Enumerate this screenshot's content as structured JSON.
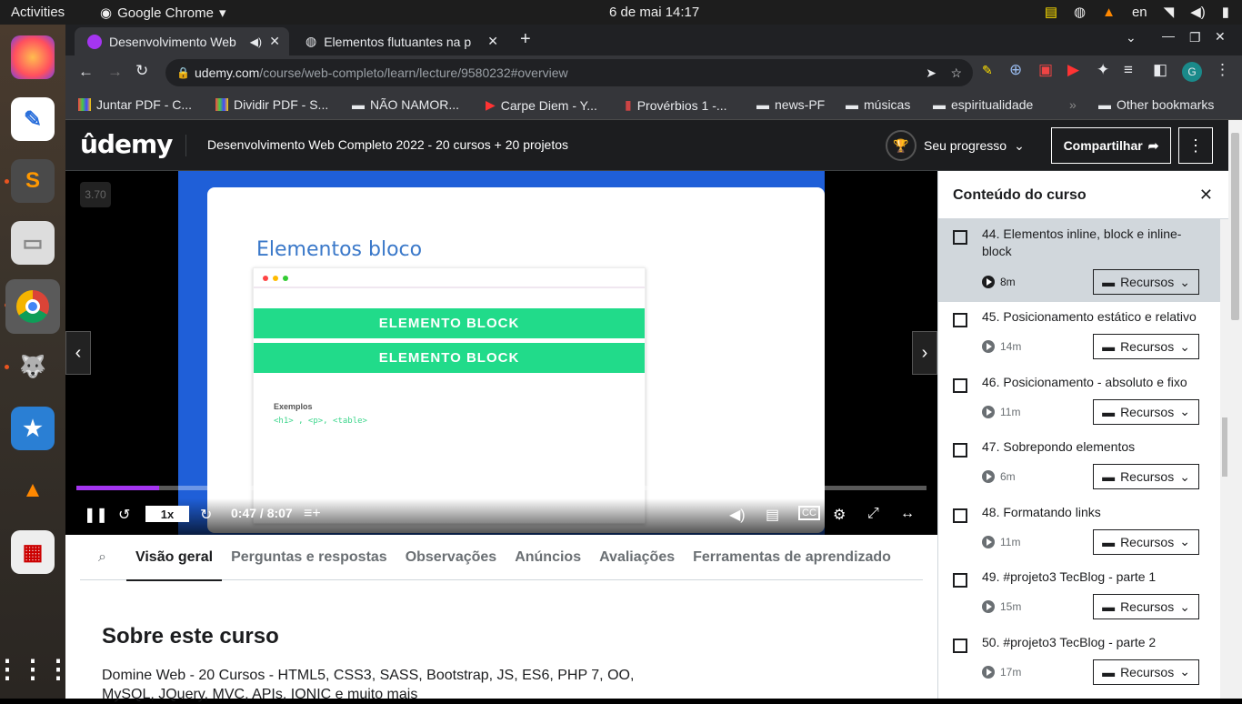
{
  "system": {
    "activities": "Activities",
    "app_name": "Google Chrome",
    "clock": "6 de mai  14:17",
    "lang": "en"
  },
  "browser": {
    "tabs": [
      {
        "title": "Desenvolvimento Web",
        "active": true
      },
      {
        "title": "Elementos flutuantes na p",
        "active": false
      }
    ],
    "url_domain": "udemy.com",
    "url_path": "/course/web-completo/learn/lecture/9580232#overview",
    "profile_initial": "G",
    "bookmarks": [
      "Juntar PDF - C...",
      "Dividir PDF - S...",
      "NÃO NAMOR...",
      "Carpe Diem - Y...",
      "Provérbios 1 -...",
      "news-PF",
      "músicas",
      "espiritualidade"
    ],
    "other_bookmarks": "Other bookmarks"
  },
  "header": {
    "logo": "ûdemy",
    "course_title": "Desenvolvimento Web Completo 2022 - 20 cursos + 20 projetos",
    "progress_label": "Seu progresso",
    "share_label": "Compartilhar"
  },
  "video": {
    "speed_badge": "3.70",
    "slide_title": "Elementos bloco",
    "block1": "ELEMENTO BLOCK",
    "block2": "ELEMENTO BLOCK",
    "examples_label": "Exemplos",
    "examples_code": "<h1> , <p>, <table>",
    "rate": "1x",
    "time": "0:47 / 8:07",
    "progress": 0.097
  },
  "tabs": [
    "Visão geral",
    "Perguntas e respostas",
    "Observações",
    "Anúncios",
    "Avaliações",
    "Ferramentas de aprendizado"
  ],
  "overview": {
    "heading": "Sobre este curso",
    "description": "Domine Web - 20 Cursos - HTML5, CSS3, SASS, Bootstrap, JS, ES6, PHP 7, OO, MySQL, JQuery, MVC, APIs, IONIC e muito mais"
  },
  "sidebar": {
    "title": "Conteúdo do curso",
    "resources_label": "Recursos",
    "lectures": [
      {
        "name": "44. Elementos inline, block e inline-block",
        "duration": "8m",
        "current": true
      },
      {
        "name": "45. Posicionamento estático e relativo",
        "duration": "14m"
      },
      {
        "name": "46. Posicionamento - absoluto e fixo",
        "duration": "11m"
      },
      {
        "name": "47. Sobrepondo elementos",
        "duration": "6m"
      },
      {
        "name": "48. Formatando links",
        "duration": "11m"
      },
      {
        "name": "49. #projeto3 TecBlog - parte 1",
        "duration": "15m"
      },
      {
        "name": "50. #projeto3 TecBlog - parte 2",
        "duration": "17m"
      }
    ]
  },
  "colors": {
    "accent": "#a435f0",
    "block": "#21db8a",
    "slide_bg": "#1f5fd8"
  }
}
